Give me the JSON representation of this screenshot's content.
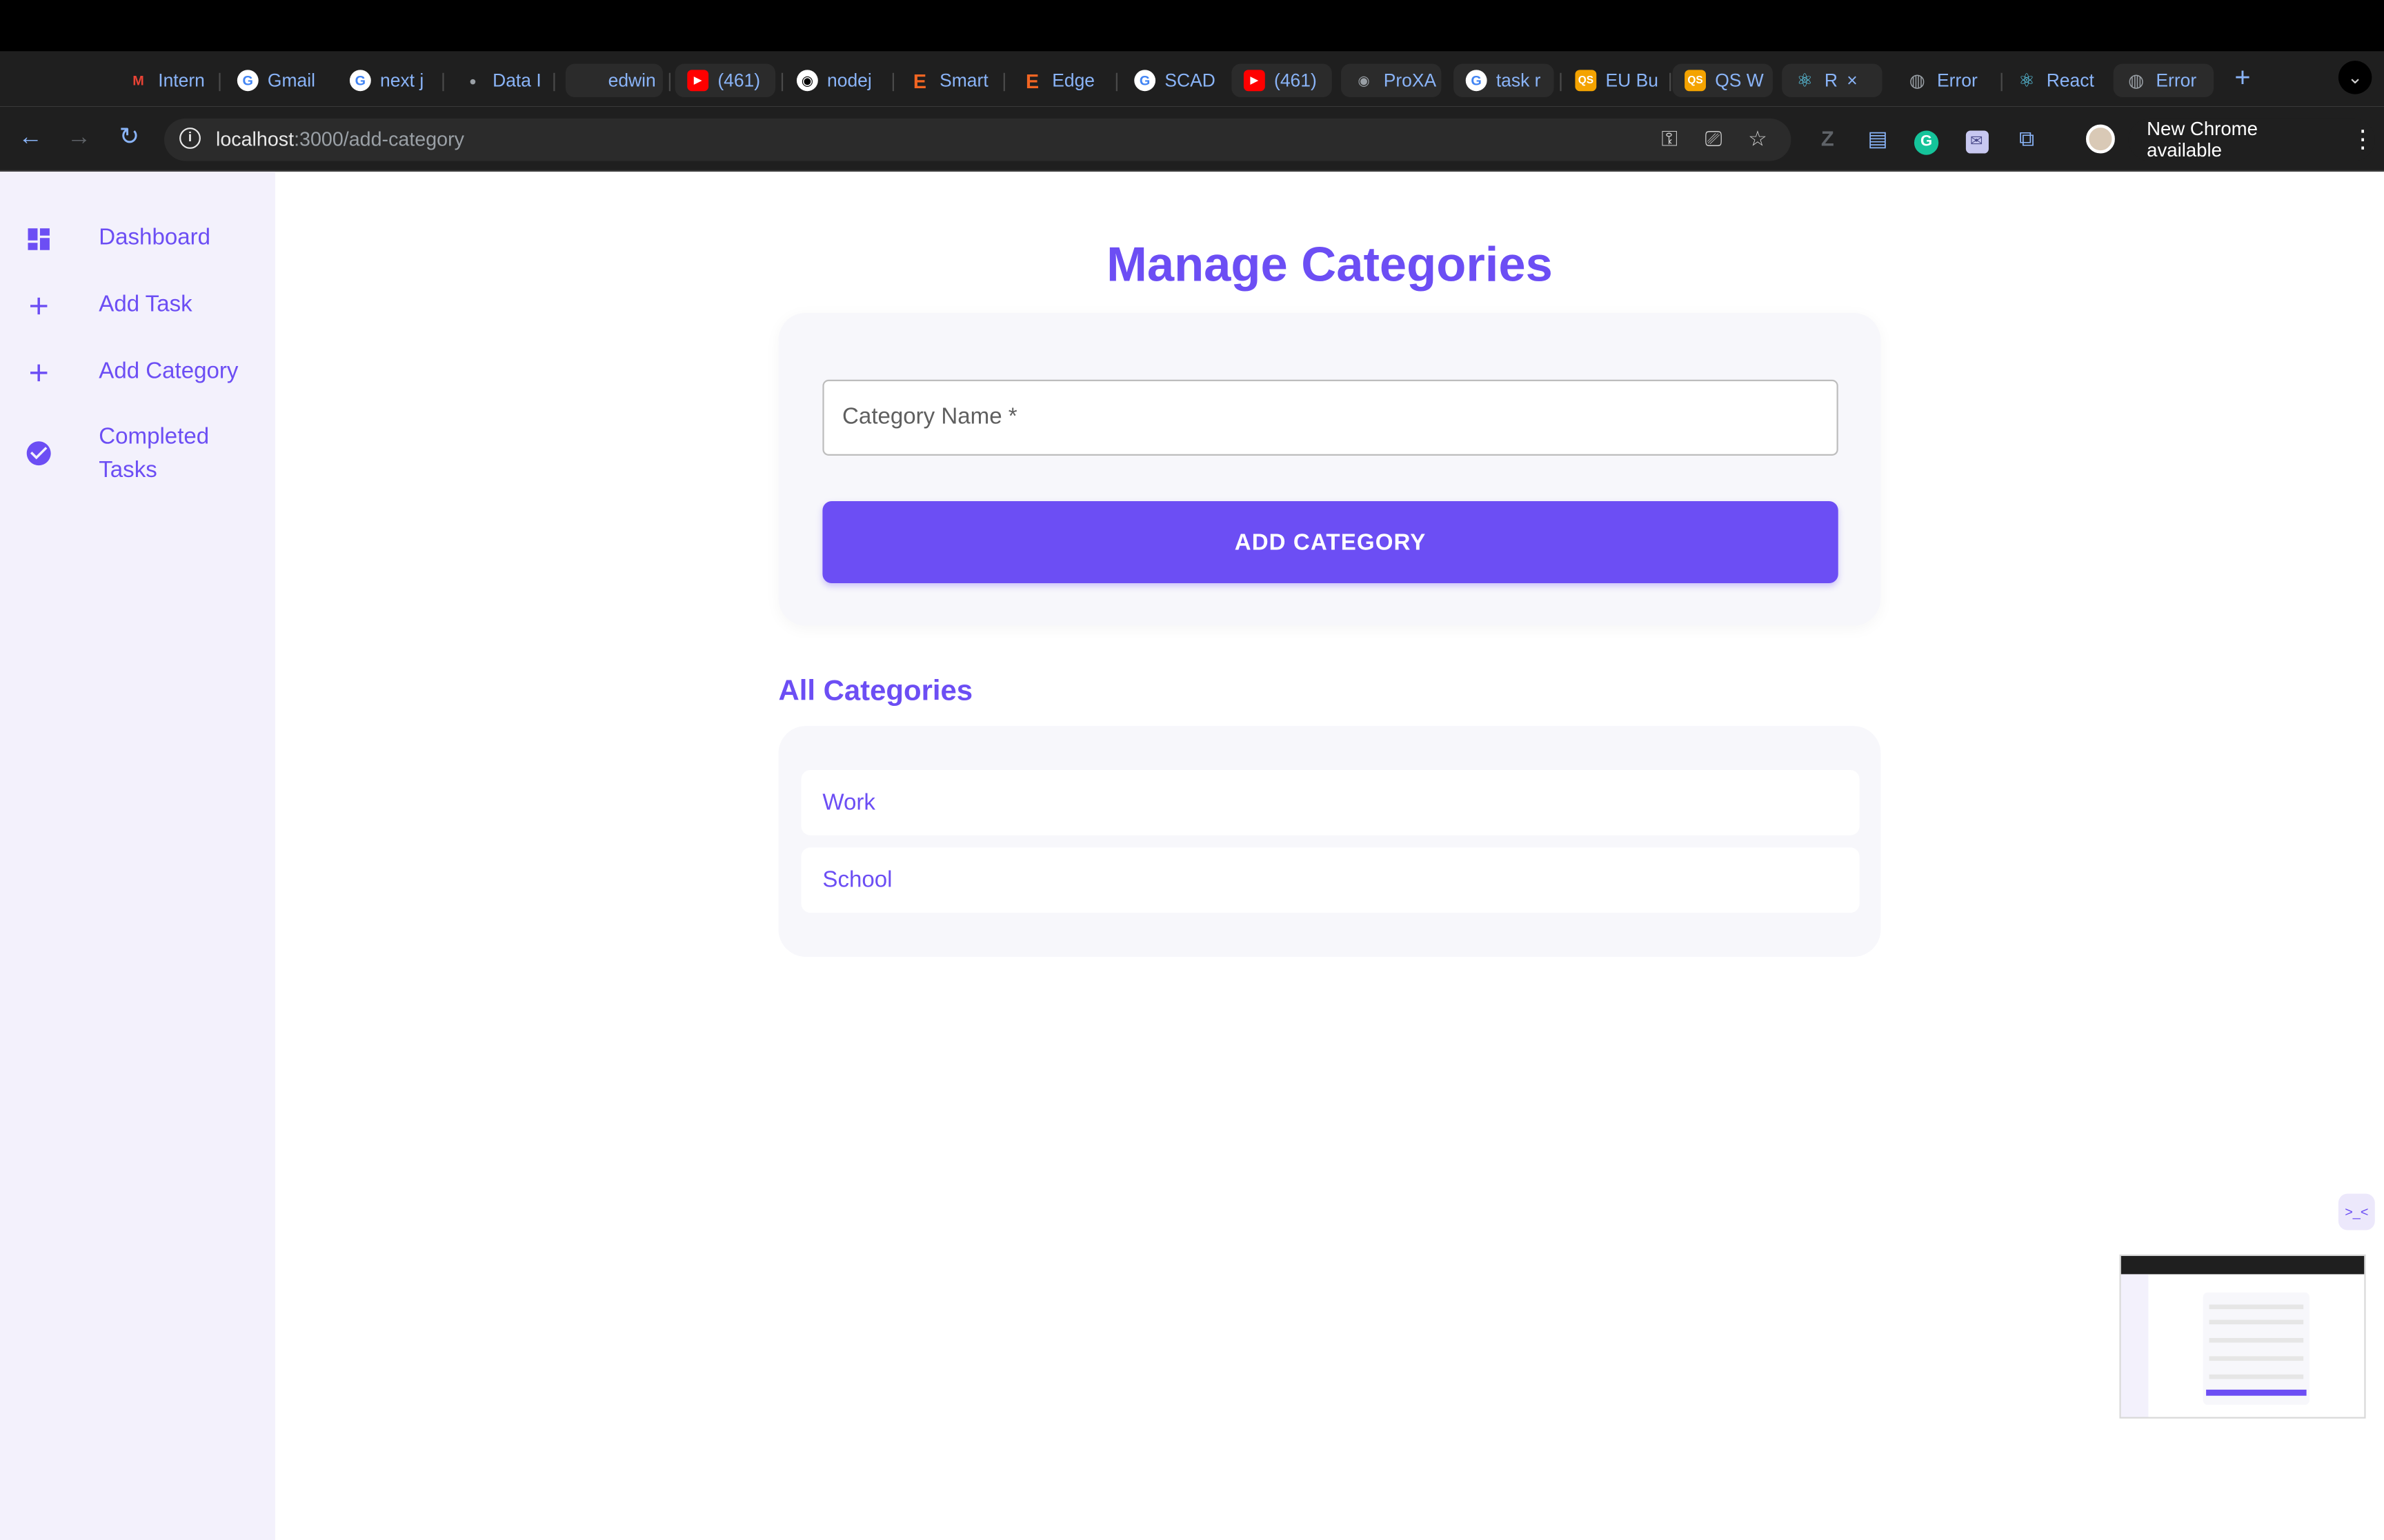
{
  "browser": {
    "tabs": [
      {
        "label": "Intern",
        "icon": "gmail-icon",
        "color": "#ea4335"
      },
      {
        "label": "Gmail",
        "icon": "google-icon",
        "color": "#ffffff"
      },
      {
        "label": "next j",
        "icon": "google-icon",
        "color": "#ffffff"
      },
      {
        "label": "Data I",
        "icon": "site-icon",
        "color": "#9aa0a6"
      },
      {
        "label": "edwin",
        "icon": "blank-icon",
        "color": "#1f1f1f"
      },
      {
        "label": "(461)",
        "icon": "youtube-icon",
        "color": "#ff0000"
      },
      {
        "label": "nodej",
        "icon": "github-icon",
        "color": "#ffffff"
      },
      {
        "label": "Smart",
        "icon": "elementor-icon",
        "color": "#f26522"
      },
      {
        "label": "Edge",
        "icon": "elementor-icon",
        "color": "#f26522"
      },
      {
        "label": "SCAD",
        "icon": "google-icon",
        "color": "#ffffff"
      },
      {
        "label": "(461)",
        "icon": "youtube-icon",
        "color": "#ff0000"
      },
      {
        "label": "ProXA",
        "icon": "github-icon",
        "color": "#9aa0a6"
      },
      {
        "label": "task r",
        "icon": "google-icon",
        "color": "#ffffff"
      },
      {
        "label": "EU Bu",
        "icon": "qs-icon",
        "color": "#f4a300"
      },
      {
        "label": "QS W",
        "icon": "qs-icon",
        "color": "#f4a300"
      },
      {
        "label": "R",
        "icon": "react-icon",
        "color": "#61dafb"
      },
      {
        "label": "Error",
        "icon": "globe-icon",
        "color": "#9aa0a6"
      },
      {
        "label": "React",
        "icon": "react-icon",
        "color": "#61dafb"
      },
      {
        "label": "Error",
        "icon": "globe-icon",
        "color": "#9aa0a6"
      }
    ],
    "active_tab_close": "×",
    "new_tab": "+",
    "url_host": "localhost",
    "url_path": ":3000/add-category",
    "update_label": "New Chrome available"
  },
  "sidebar": {
    "items": [
      {
        "label": "Dashboard",
        "icon": "dashboard-icon"
      },
      {
        "label": "Add Task",
        "icon": "plus-icon"
      },
      {
        "label": "Add Category",
        "icon": "plus-icon"
      },
      {
        "label": "Completed Tasks",
        "icon": "check-circle-icon"
      }
    ]
  },
  "main": {
    "title": "Manage Categories",
    "input_label": "Category Name *",
    "input_value": "",
    "add_button": "ADD CATEGORY",
    "list_title": "All Categories",
    "categories": [
      "Work",
      "School"
    ]
  },
  "colors": {
    "accent": "#6c4ef4",
    "sidebar_bg": "#f3f1fc",
    "card_bg": "#f7f7fb"
  }
}
